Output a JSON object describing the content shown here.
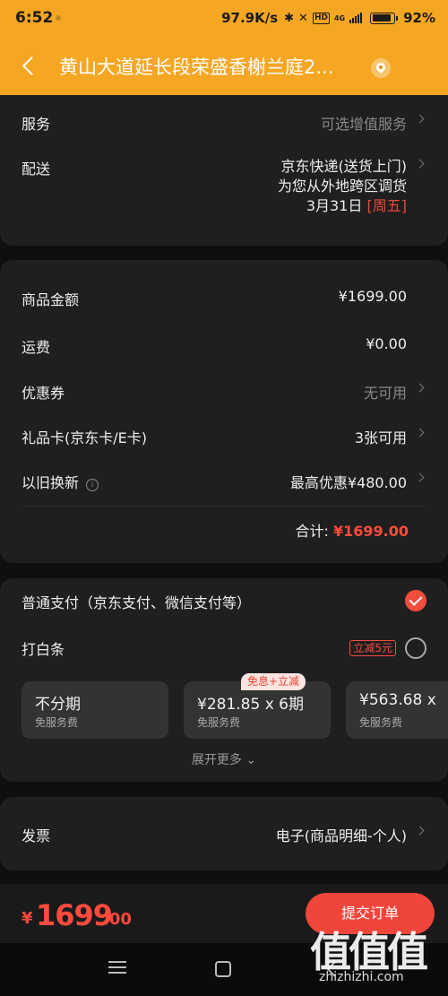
{
  "status_bar": {
    "time": "6:52",
    "net_speed": "97.9K/s",
    "network": "4G",
    "hd": "HD",
    "battery": "92%",
    "battery_level": 0.92
  },
  "header": {
    "title": "黄山大道延长段荣盛香榭兰庭2..."
  },
  "service_card": {
    "service_label": "服务",
    "service_value": "可选增值服务",
    "delivery_label": "配送",
    "delivery_method": "京东快递(送货上门)",
    "delivery_note": "为您从外地跨区调货",
    "delivery_date": "3月31日",
    "delivery_weekday": "[周五]"
  },
  "price_card": {
    "goods_label": "商品金额",
    "goods_value": "¥1699.00",
    "shipping_label": "运费",
    "shipping_value": "¥0.00",
    "coupon_label": "优惠券",
    "coupon_value": "无可用",
    "giftcard_label": "礼品卡(京东卡/E卡)",
    "giftcard_value": "3张可用",
    "tradein_label": "以旧换新",
    "tradein_value": "最高优惠¥480.00",
    "total_label": "合计:",
    "total_value": "¥1699.00"
  },
  "payment_card": {
    "normal_label": "普通支付（京东支付、微信支付等）",
    "normal_selected": true,
    "baitiao_label": "打白条",
    "baitiao_tag": "立减5元",
    "baitiao_selected": false,
    "plan_badge": "免息+立减",
    "plans": [
      {
        "main": "不分期",
        "sub": "免服务费"
      },
      {
        "main": "¥281.85 x 6期",
        "sub": "免服务费"
      },
      {
        "main": "¥563.68 x",
        "sub": "免服务费"
      }
    ],
    "expand_label": "展开更多",
    "expand_icon": "chevron-down-icon"
  },
  "invoice_card": {
    "label": "发票",
    "value": "电子(商品明细-个人)"
  },
  "bottom": {
    "currency": "¥",
    "price_int": "1699",
    "price_dec": ".00",
    "submit_label": "提交订单"
  },
  "watermark": {
    "glyphs": "值值值",
    "text": "zhizhizhi.com"
  },
  "colors": {
    "brand_orange": "#f5a623",
    "accent_red": "#f0453a",
    "price_red": "#ff4a3d",
    "card_bg": "#1f1f1f"
  }
}
